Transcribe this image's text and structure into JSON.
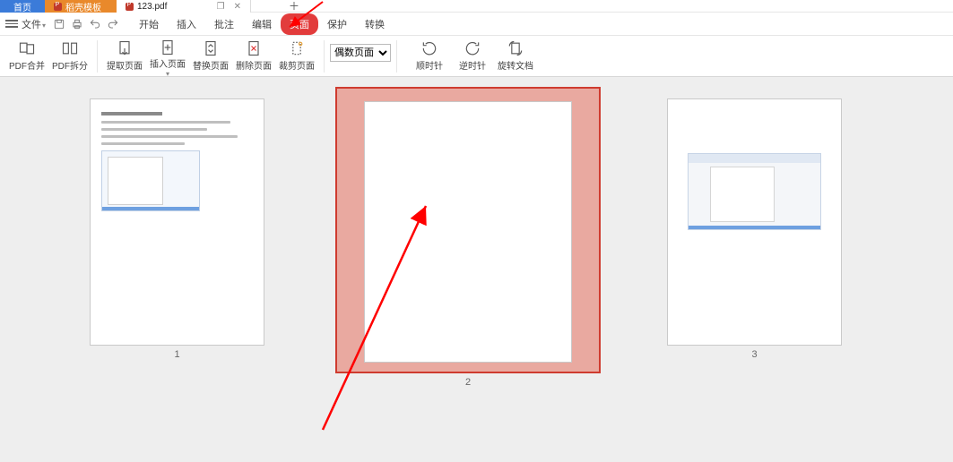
{
  "tabs": {
    "home": "首页",
    "doc1": "稻壳模板",
    "doc2": "123.pdf",
    "window_ctrl1": "❐",
    "window_ctrl2": "✕",
    "add": "＋"
  },
  "menubar": {
    "file": "文件",
    "items": [
      "开始",
      "插入",
      "批注",
      "编辑",
      "页面",
      "保护",
      "转换"
    ],
    "active_index": 4
  },
  "ribbon": {
    "btns": [
      {
        "id": "pdf-merge",
        "label": "PDF合并"
      },
      {
        "id": "pdf-split",
        "label": "PDF拆分"
      },
      {
        "id": "extract-page",
        "label": "提取页面"
      },
      {
        "id": "insert-page",
        "label": "插入页面"
      },
      {
        "id": "replace-page",
        "label": "替换页面"
      },
      {
        "id": "delete-page",
        "label": "删除页面"
      },
      {
        "id": "crop-page",
        "label": "裁剪页面"
      }
    ],
    "page_select_value": "偶数页面",
    "rotation": [
      {
        "id": "rotate-cw",
        "label": "顺时针"
      },
      {
        "id": "rotate-ccw",
        "label": "逆时针"
      },
      {
        "id": "rotate-doc",
        "label": "旋转文档"
      }
    ]
  },
  "pages": {
    "p1_number": "1",
    "p2_number": "2",
    "p3_number": "3"
  }
}
